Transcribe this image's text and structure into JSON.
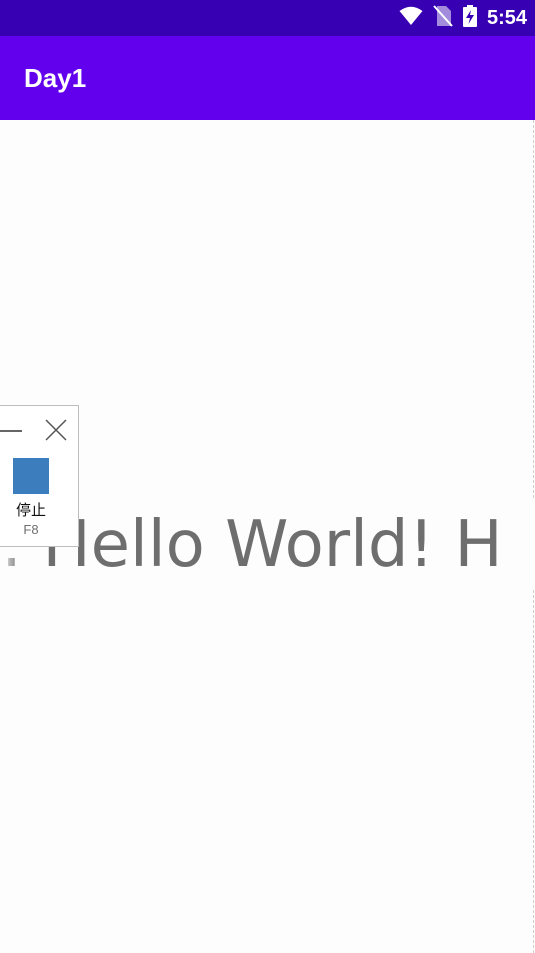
{
  "status_bar": {
    "time": "5:54",
    "icons": [
      "wifi-icon",
      "no-sim-icon",
      "battery-charging-icon"
    ],
    "background": "#3700b3"
  },
  "app_bar": {
    "title": "Day1",
    "background": "#6200ee"
  },
  "content": {
    "marquee_text": "d: Hello World! H"
  },
  "float_panel": {
    "minimize_icon": "minimize-icon",
    "close_icon": "close-icon",
    "stop_label": "停止",
    "stop_shortcut": "F8",
    "stop_color": "#3b7dbd"
  }
}
